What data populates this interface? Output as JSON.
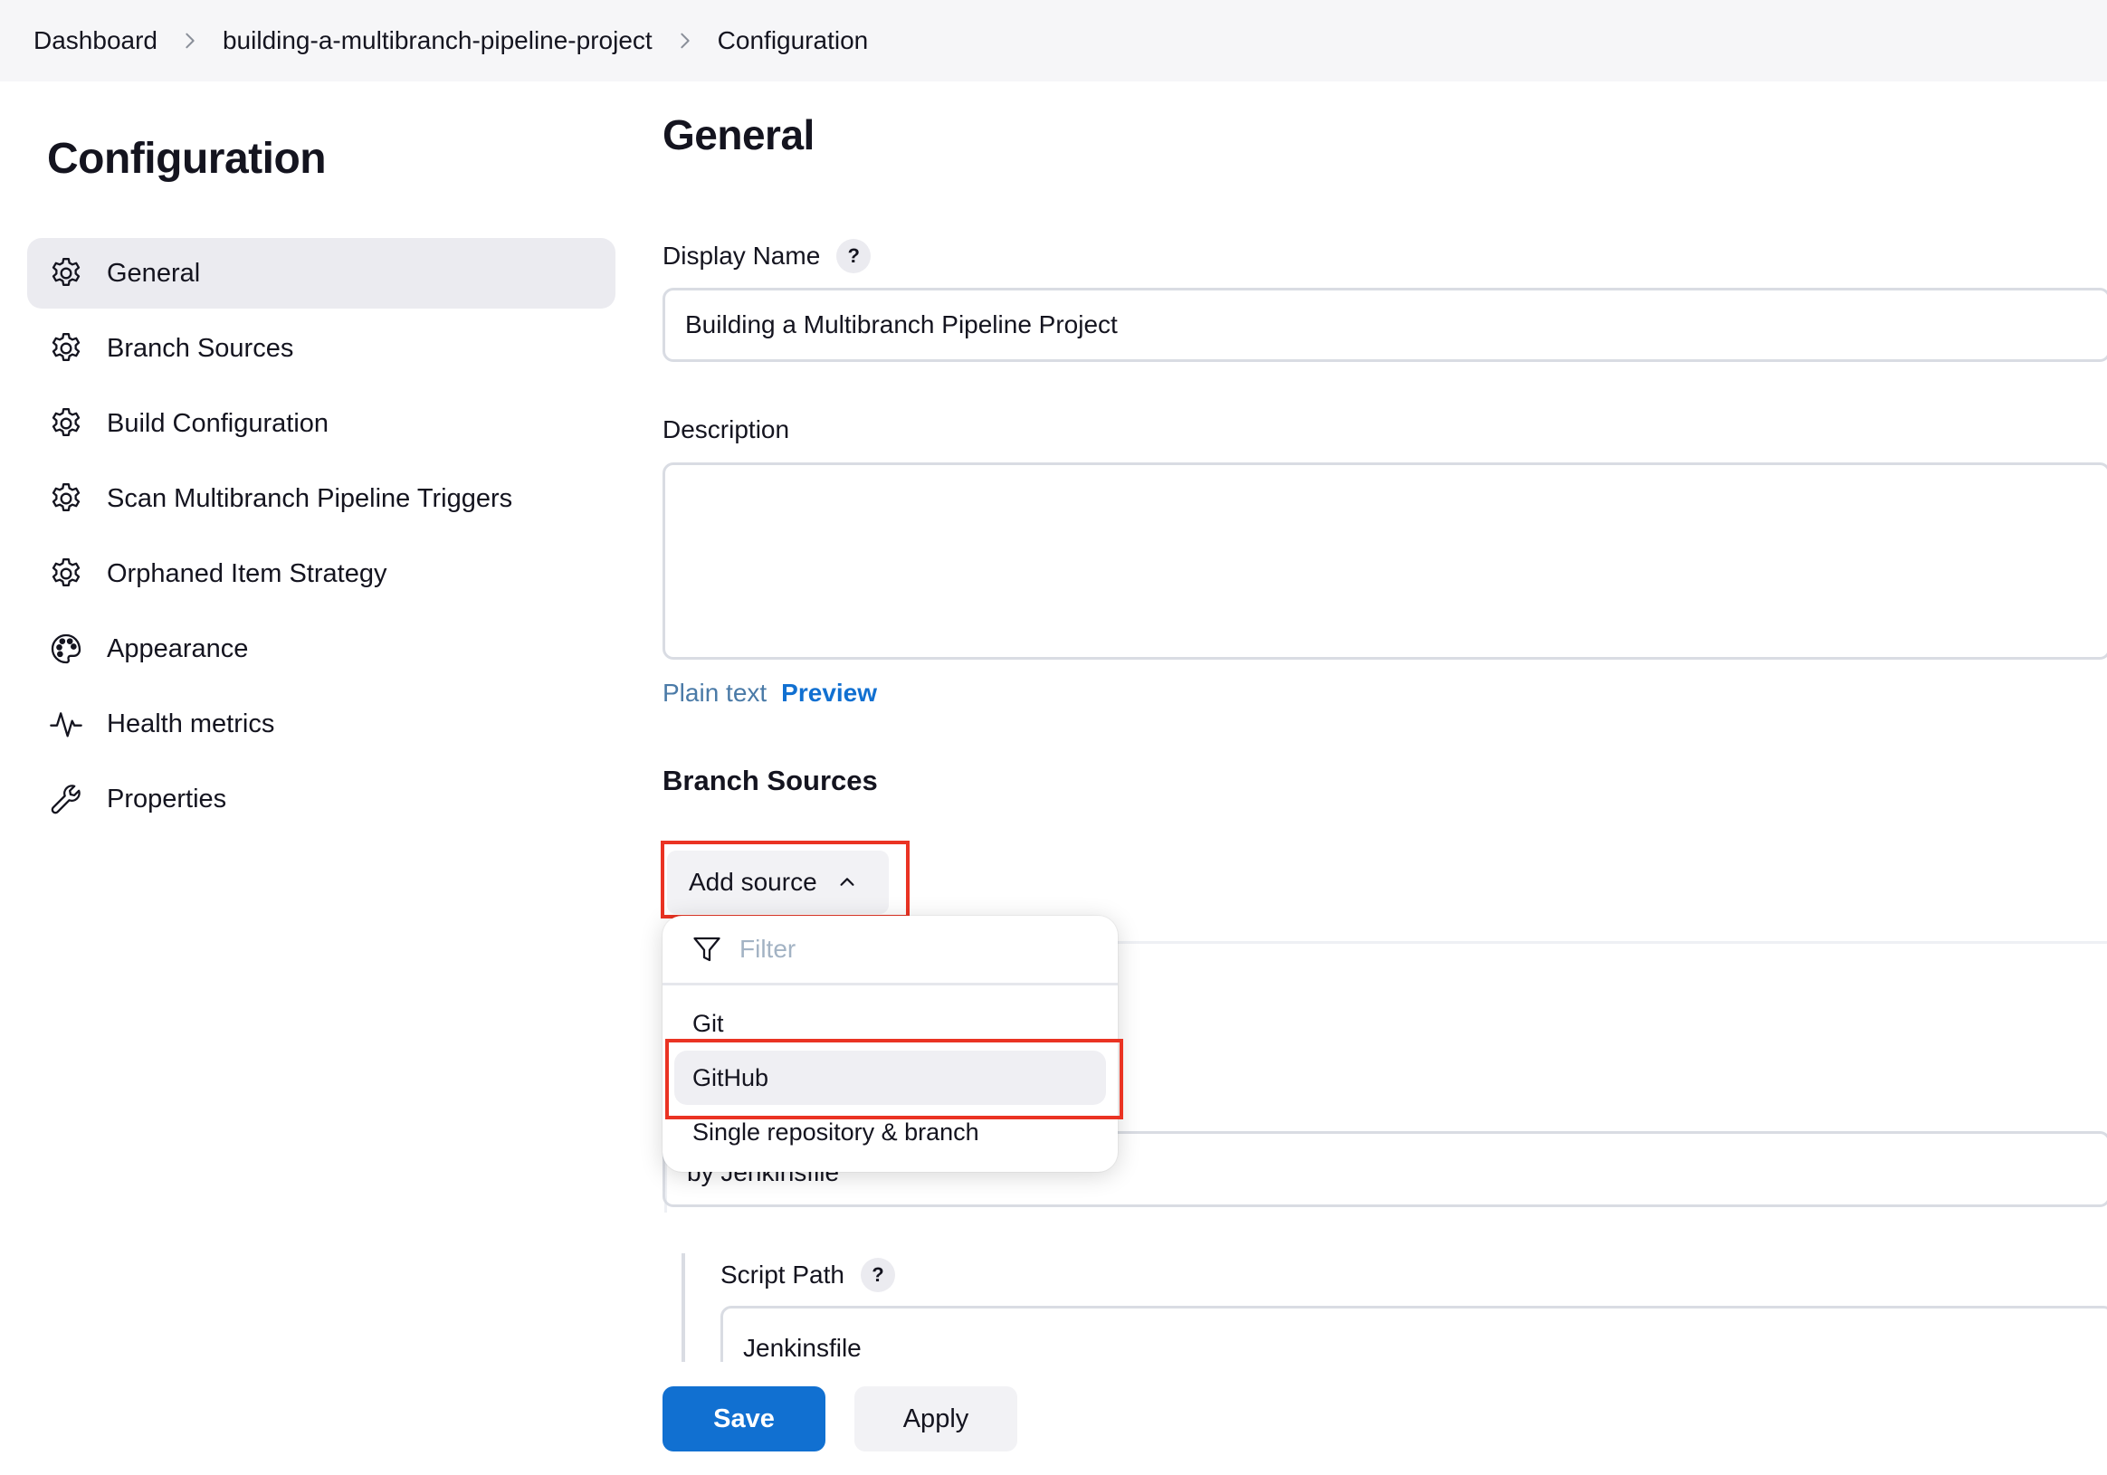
{
  "breadcrumb": {
    "items": [
      "Dashboard",
      "building-a-multibranch-pipeline-project",
      "Configuration"
    ]
  },
  "sidebar": {
    "title": "Configuration",
    "items": [
      {
        "label": "General",
        "icon": "gear-icon",
        "active": true
      },
      {
        "label": "Branch Sources",
        "icon": "gear-icon"
      },
      {
        "label": "Build Configuration",
        "icon": "gear-icon"
      },
      {
        "label": "Scan Multibranch Pipeline Triggers",
        "icon": "gear-icon"
      },
      {
        "label": "Orphaned Item Strategy",
        "icon": "gear-icon"
      },
      {
        "label": "Appearance",
        "icon": "palette-icon"
      },
      {
        "label": "Health metrics",
        "icon": "pulse-icon"
      },
      {
        "label": "Properties",
        "icon": "wrench-icon"
      }
    ]
  },
  "main": {
    "section_title": "General",
    "display_name": {
      "label": "Display Name",
      "help": "?",
      "value": "Building a Multibranch Pipeline Project"
    },
    "description": {
      "label": "Description",
      "value": ""
    },
    "format": {
      "plain": "Plain text",
      "preview": "Preview"
    },
    "branch_sources": {
      "title": "Branch Sources",
      "add_button": "Add source",
      "dropdown": {
        "filter_placeholder": "Filter",
        "options": [
          "Git",
          "GitHub",
          "Single repository & branch"
        ],
        "hovered": "GitHub"
      }
    },
    "build_mode_value": "by Jenkinsfile",
    "script_path": {
      "label": "Script Path",
      "help": "?",
      "value": "Jenkinsfile"
    }
  },
  "actions": {
    "save": "Save",
    "apply": "Apply"
  },
  "colors": {
    "primary": "#1170d1",
    "highlight": "#ea3323"
  }
}
